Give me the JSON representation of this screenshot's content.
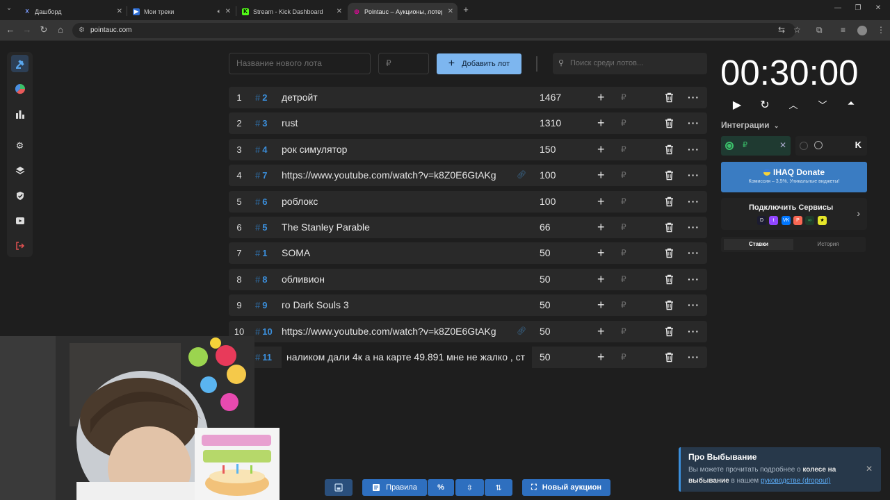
{
  "browser": {
    "tabs": [
      {
        "title": "Дашборд",
        "favicon": "X"
      },
      {
        "title": "Мои треки",
        "favicon": "▶"
      },
      {
        "title": "Stream - Kick Dashboard",
        "favicon": "K"
      },
      {
        "title": "Pointauc – Аукционы, лотереи",
        "favicon": "◎"
      }
    ],
    "url": "pointauc.com"
  },
  "toolbar": {
    "lot_name_placeholder": "Название нового лота",
    "amount_placeholder": "₽",
    "add_lot_label": "Добавить лот",
    "search_placeholder": "Поиск среди лотов..."
  },
  "lots": [
    {
      "index": "1",
      "num": "2",
      "name": "детройт",
      "amount": "1467",
      "link": false
    },
    {
      "index": "2",
      "num": "3",
      "name": "rust",
      "amount": "1310",
      "link": false
    },
    {
      "index": "3",
      "num": "4",
      "name": "рок симулятор",
      "amount": "150",
      "link": false
    },
    {
      "index": "4",
      "num": "7",
      "name": "https://www.youtube.com/watch?v=k8Z0E6GtAKg",
      "amount": "100",
      "link": true
    },
    {
      "index": "5",
      "num": "6",
      "name": "роблокс",
      "amount": "100",
      "link": false
    },
    {
      "index": "6",
      "num": "5",
      "name": "The Stanley Parable",
      "amount": "66",
      "link": false
    },
    {
      "index": "7",
      "num": "1",
      "name": "SOMA",
      "amount": "50",
      "link": false
    },
    {
      "index": "8",
      "num": "8",
      "name": "обливион",
      "amount": "50",
      "link": false
    },
    {
      "index": "9",
      "num": "9",
      "name": "го Dark Souls 3",
      "amount": "50",
      "link": false
    },
    {
      "index": "10",
      "num": "10",
      "name": "https://www.youtube.com/watch?v=k8Z0E6GtAKg",
      "amount": "50",
      "link": true
    },
    {
      "index": "",
      "num": "11",
      "name": "наликом дали 4к а на карте 49.891 мне не жалко , ст",
      "amount": "50",
      "link": false,
      "editing": true
    }
  ],
  "currency_symbol": "₽",
  "timer": {
    "value": "00:30:00"
  },
  "integrations": {
    "label": "Интеграции",
    "donate_title": "IHAQ Donate",
    "donate_subtitle": "Комиссия – 3,5%. Уникальные виджеты!",
    "connect_services": "Подключить Сервисы"
  },
  "side_tabs": {
    "bets": "Ставки",
    "history": "История"
  },
  "bottom": {
    "rules_label": "Правила",
    "new_auction_label": "Новый аукцион"
  },
  "toast": {
    "title": "Про Выбывание",
    "body_prefix": "Вы можете прочитать подробнее о",
    "body_bold": "колесе на выбывание",
    "body_mid": "в нашем",
    "body_link": "руководстве (dropout)"
  },
  "colors": {
    "accent": "#3b8fdc",
    "add_button": "#7db6ef",
    "donate": "#3a7cc2",
    "row_bg": "#292929"
  }
}
